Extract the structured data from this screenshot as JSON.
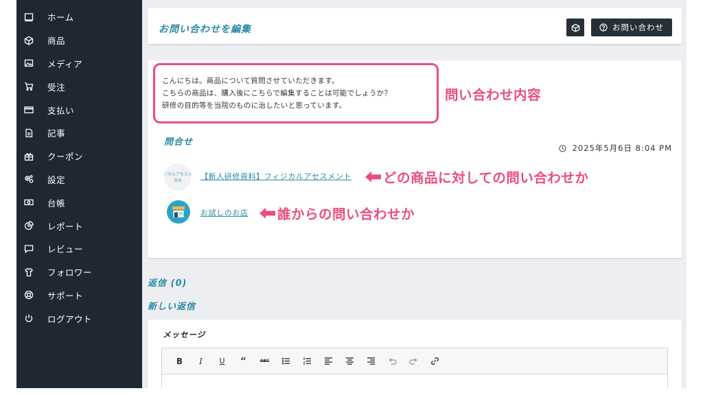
{
  "sidebar": {
    "items": [
      {
        "label": "ホーム",
        "icon": "home-icon"
      },
      {
        "label": "商品",
        "icon": "cube-icon"
      },
      {
        "label": "メディア",
        "icon": "image-icon"
      },
      {
        "label": "受注",
        "icon": "cart-icon"
      },
      {
        "label": "支払い",
        "icon": "credit-card-icon"
      },
      {
        "label": "記事",
        "icon": "document-icon"
      },
      {
        "label": "クーポン",
        "icon": "gift-icon"
      },
      {
        "label": "設定",
        "icon": "gears-icon"
      },
      {
        "label": "台帳",
        "icon": "money-icon"
      },
      {
        "label": "レポート",
        "icon": "pie-chart-icon"
      },
      {
        "label": "レビュー",
        "icon": "comment-icon"
      },
      {
        "label": "フォロワー",
        "icon": "shirt-icon"
      },
      {
        "label": "サポート",
        "icon": "lifebuoy-icon"
      },
      {
        "label": "ログアウト",
        "icon": "power-icon"
      }
    ]
  },
  "header": {
    "title": "お問い合わせを編集",
    "inquiry_button": "お問い合わせ"
  },
  "inquiry": {
    "message_lines": [
      "こんにちは。商品について質問させていただきます。",
      "こちらの商品は、購入後にこちらで編集することは可能でしょうか？",
      "研修の目的等を当院のものに治したいと思っています。"
    ],
    "section_title": "問合せ",
    "timestamp": "2025年5月6日 8:04 PM",
    "product_thumb_line1": "ジカルアセスメ",
    "product_thumb_line2": "概論",
    "product_link": "【新人研修資料】フィジカルアセスメント",
    "store_link": "お試しのお店"
  },
  "annotations": {
    "content": "問い合わせ内容",
    "product": "どの商品に対しての問い合わせか",
    "sender": "誰からの問い合わせか"
  },
  "replies": {
    "title": "返信 (0)",
    "new_title": "新しい返信",
    "message_label": "メッセージ"
  },
  "toolbar": {
    "bold": "B",
    "italic": "I",
    "underline": "U",
    "quote": "“",
    "strike": "ABC"
  },
  "colors": {
    "sidebar_bg": "#1e2732",
    "accent": "#2a8aa6",
    "annotation": "#ea4d7a",
    "button_dark": "#263038"
  }
}
